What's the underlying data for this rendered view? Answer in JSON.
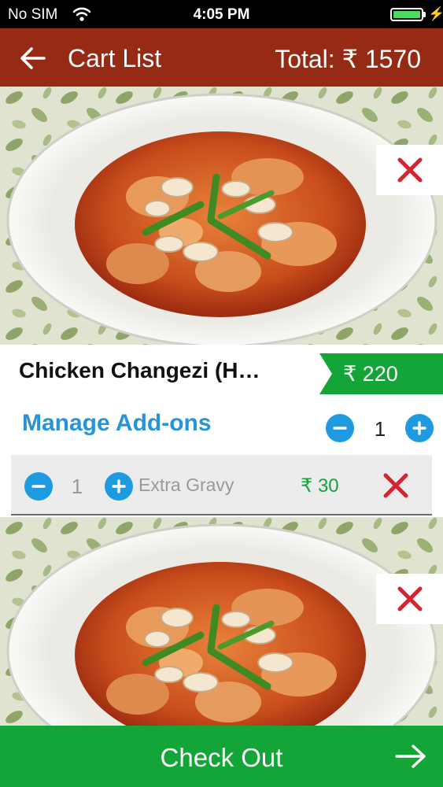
{
  "status_bar": {
    "carrier": "No SIM",
    "time": "4:05 PM",
    "battery_percent": 100,
    "icons": [
      "wifi-icon",
      "battery-icon",
      "charging-bolt-icon"
    ]
  },
  "header": {
    "title": "Cart List",
    "total": "Total:  ₹ 1570",
    "icons": [
      "back-arrow-icon"
    ]
  },
  "cart_items": [
    {
      "name": "Chicken Changezi (H…",
      "price": "₹ 220",
      "manage_addons_label": "Manage Add-ons",
      "quantity": "1",
      "addons": [
        {
          "quantity": "1",
          "name": "Extra Gravy",
          "price": "₹ 30"
        }
      ]
    }
  ],
  "checkout": {
    "label": "Check Out"
  },
  "colors": {
    "header": "#972a14",
    "accent_green": "#13a538",
    "accent_blue": "#1e9ae0",
    "link_blue": "#2694d6",
    "remove_red": "#d42430"
  }
}
